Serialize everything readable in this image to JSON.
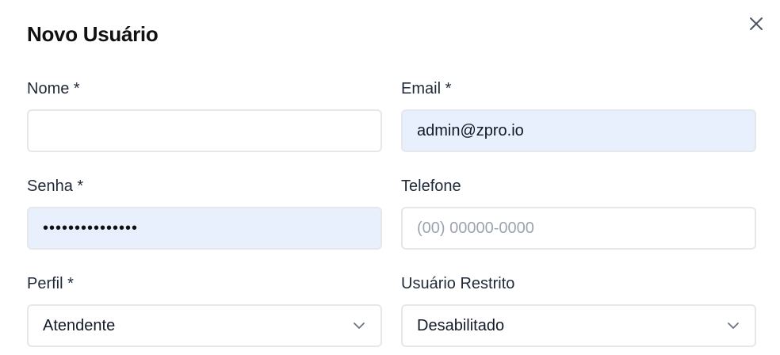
{
  "dialog": {
    "title": "Novo Usuário"
  },
  "fields": {
    "name": {
      "label": "Nome *",
      "value": "",
      "placeholder": ""
    },
    "email": {
      "label": "Email *",
      "value": "admin@zpro.io"
    },
    "password": {
      "label": "Senha *",
      "value": "•••••••••••••••"
    },
    "phone": {
      "label": "Telefone",
      "value": "",
      "placeholder": "(00) 00000-0000"
    },
    "profile": {
      "label": "Perfil *",
      "selected": "Atendente"
    },
    "restricted": {
      "label": "Usuário Restrito",
      "selected": "Desabilitado"
    }
  },
  "icons": {
    "close": "close-icon",
    "chevron": "chevron-down-icon"
  },
  "colors": {
    "autofill_bg": "#e8effd",
    "border": "#e5e7eb",
    "placeholder": "#9ca3af"
  }
}
